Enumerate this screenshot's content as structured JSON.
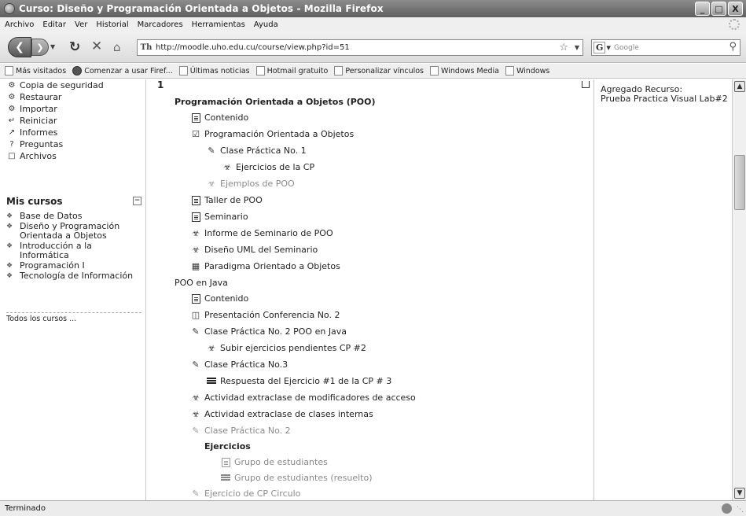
{
  "window": {
    "title": "Curso: Diseño y Programación Orientada a Objetos - Mozilla Firefox",
    "buttons": {
      "minimize": "_",
      "maximize": "□",
      "close": "X"
    }
  },
  "menu": [
    "Archivo",
    "Editar",
    "Ver",
    "Historial",
    "Marcadores",
    "Herramientas",
    "Ayuda"
  ],
  "nav": {
    "url": "http://moodle.uho.edu.cu/course/view.php?id=51",
    "site_icon_text": "Th",
    "search_engine": "G",
    "search_placeholder": "Google"
  },
  "bookmarks": [
    "Más visitados",
    "Comenzar a usar Firef...",
    "Últimas noticias",
    "Hotmail gratuito",
    "Personalizar vínculos",
    "Windows Media",
    "Windows"
  ],
  "admin_block": {
    "items": [
      {
        "label": "Copia de seguridad",
        "icon": "backup-icon"
      },
      {
        "label": "Restaurar",
        "icon": "restore-icon"
      },
      {
        "label": "Importar",
        "icon": "import-icon"
      },
      {
        "label": "Reiniciar",
        "icon": "reset-icon"
      },
      {
        "label": "Informes",
        "icon": "reports-icon"
      },
      {
        "label": "Preguntas",
        "icon": "questions-icon"
      },
      {
        "label": "Archivos",
        "icon": "folder-icon"
      }
    ]
  },
  "my_courses": {
    "title": "Mis cursos",
    "items": [
      "Base de Datos",
      "Diseño y Programación Orientada a Objetos",
      "Introducción a la Informática",
      "Programación I",
      "Tecnología de Información"
    ],
    "all_courses": "Todos los cursos ..."
  },
  "main": {
    "section_number": "1",
    "section1_title": "Programación Orientada a Objetos (POO)",
    "section2_title": "POO en Java",
    "subsection_title": "Ejercicios",
    "activities": [
      {
        "label": "Contenido",
        "icon": "document-icon",
        "dim": false
      },
      {
        "label": "Programación Orientada a Objetos",
        "icon": "checkbox-icon",
        "dim": false
      },
      {
        "label": "Clase Práctica No. 1",
        "icon": "assignment-icon",
        "dim": false
      },
      {
        "label": "Ejercicios de la CP",
        "icon": "forum-icon",
        "dim": false
      },
      {
        "label": "Ejemplos de POO",
        "icon": "forum-icon",
        "dim": true
      },
      {
        "label": "Taller de POO",
        "icon": "document-icon",
        "dim": false
      },
      {
        "label": "Seminario",
        "icon": "document-icon",
        "dim": false
      },
      {
        "label": "Informe de Seminario de POO",
        "icon": "forum-icon",
        "dim": false
      },
      {
        "label": "Diseño UML del Seminario",
        "icon": "forum-icon",
        "dim": false
      },
      {
        "label": "Paradigma Orientado a Objetos",
        "icon": "glossary-icon",
        "dim": false
      },
      {
        "label": "Contenido",
        "icon": "document-icon",
        "dim": false
      },
      {
        "label": "Presentación Conferencia No. 2",
        "icon": "presentation-icon",
        "dim": false
      },
      {
        "label": "Clase Práctica No. 2 POO en Java",
        "icon": "assignment-icon",
        "dim": false
      },
      {
        "label": "Subir ejercicios pendientes CP #2",
        "icon": "forum-icon",
        "dim": false
      },
      {
        "label": "Clase Práctica No.3",
        "icon": "assignment-icon",
        "dim": false
      },
      {
        "label": "Respuesta del Ejercicio #1 de la CP # 3",
        "icon": "resource-icon",
        "dim": false
      },
      {
        "label": "Actividad extraclase de modificadores de acceso",
        "icon": "forum-icon",
        "dim": false
      },
      {
        "label": "Actividad extraclase de clases internas",
        "icon": "forum-icon",
        "dim": false
      },
      {
        "label": "Clase Práctica No. 2",
        "icon": "assignment-icon",
        "dim": true
      },
      {
        "label": "Grupo de estudiantes",
        "icon": "document-icon",
        "dim": true
      },
      {
        "label": "Grupo de estudiantes (resuelto)",
        "icon": "resource-icon",
        "dim": true
      },
      {
        "label": "Ejercicio de CP Circulo",
        "icon": "assignment-icon",
        "dim": true
      }
    ]
  },
  "recent_activity": {
    "line1": "Agregado Recurso:",
    "line2": "Prueba Practica Visual Lab#2"
  },
  "status": {
    "text": "Terminado"
  }
}
